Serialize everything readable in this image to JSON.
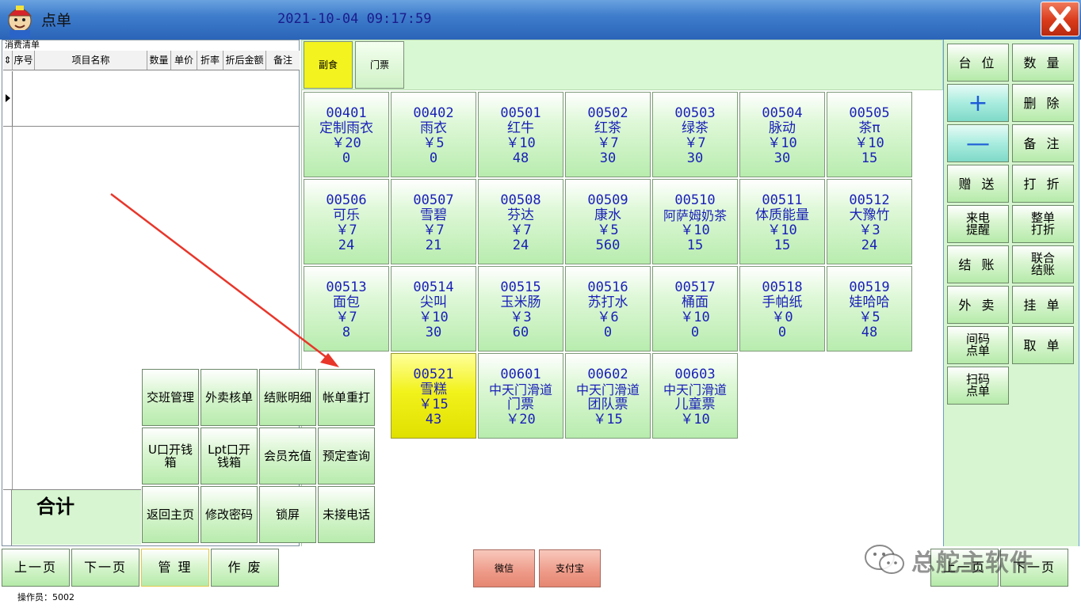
{
  "window": {
    "title": "点单",
    "datetime": "2021-10-04 09:17:59"
  },
  "order_list": {
    "caption": "消费清单",
    "columns": [
      "序号",
      "项目名称",
      "数量",
      "单价",
      "折率",
      "折后金额",
      "备注"
    ],
    "total_label": "合计"
  },
  "categories": [
    {
      "label": "副食",
      "active": true
    },
    {
      "label": "门票",
      "active": false
    }
  ],
  "products": [
    {
      "code": "00401",
      "name": "定制雨衣",
      "price": "￥20",
      "stock": "0"
    },
    {
      "code": "00402",
      "name": "雨衣",
      "price": "￥5",
      "stock": "0"
    },
    {
      "code": "00501",
      "name": "红牛",
      "price": "￥10",
      "stock": "48"
    },
    {
      "code": "00502",
      "name": "红茶",
      "price": "￥7",
      "stock": "30"
    },
    {
      "code": "00503",
      "name": "绿茶",
      "price": "￥7",
      "stock": "30"
    },
    {
      "code": "00504",
      "name": "脉动",
      "price": "￥10",
      "stock": "30"
    },
    {
      "code": "00505",
      "name": "茶π",
      "price": "￥10",
      "stock": "15"
    },
    {
      "code": "00506",
      "name": "可乐",
      "price": "￥7",
      "stock": "24"
    },
    {
      "code": "00507",
      "name": "雪碧",
      "price": "￥7",
      "stock": "21"
    },
    {
      "code": "00508",
      "name": "芬达",
      "price": "￥7",
      "stock": "24"
    },
    {
      "code": "00509",
      "name": "康水",
      "price": "￥5",
      "stock": "560"
    },
    {
      "code": "00510",
      "name": "阿萨姆奶茶",
      "price": "￥10",
      "stock": "15"
    },
    {
      "code": "00511",
      "name": "体质能量",
      "price": "￥10",
      "stock": "15"
    },
    {
      "code": "00512",
      "name": "大豫竹",
      "price": "￥3",
      "stock": "24"
    },
    {
      "code": "00513",
      "name": "面包",
      "price": "￥7",
      "stock": "8"
    },
    {
      "code": "00514",
      "name": "尖叫",
      "price": "￥10",
      "stock": "30"
    },
    {
      "code": "00515",
      "name": "玉米肠",
      "price": "￥3",
      "stock": "60"
    },
    {
      "code": "00516",
      "name": "苏打水",
      "price": "￥6",
      "stock": "0"
    },
    {
      "code": "00517",
      "name": "桶面",
      "price": "￥10",
      "stock": "0"
    },
    {
      "code": "00518",
      "name": "手帕纸",
      "price": "￥0",
      "stock": "0"
    },
    {
      "code": "00519",
      "name": "娃哈哈",
      "price": "￥5",
      "stock": "48"
    },
    {
      "code": "00521",
      "name": "雪糕",
      "price": "￥15",
      "stock": "43",
      "selected": true
    },
    {
      "code": "00601",
      "name": "中天门滑道",
      "name2": "门票",
      "price": "￥20"
    },
    {
      "code": "00602",
      "name": "中天门滑道",
      "name2": "团队票",
      "price": "￥15"
    },
    {
      "code": "00603",
      "name": "中天门滑道",
      "name2": "儿童票",
      "price": "￥10"
    }
  ],
  "management_menu": [
    {
      "line1": "交班管理"
    },
    {
      "line1": "外卖核单"
    },
    {
      "line1": "结账明细"
    },
    {
      "line1": "帐单重打"
    },
    {
      "line1": "U口开钱",
      "line2": "箱"
    },
    {
      "line1": "Lpt口开",
      "line2": "钱箱"
    },
    {
      "line1": "会员充值"
    },
    {
      "line1": "预定查询"
    },
    {
      "line1": "返回主页"
    },
    {
      "line1": "修改密码"
    },
    {
      "line1": "锁屏"
    },
    {
      "line1": "未接电话"
    }
  ],
  "functions": [
    {
      "line1": "台 位"
    },
    {
      "line1": "数 量"
    },
    {
      "line1": "+",
      "symbol": true
    },
    {
      "line1": "删 除"
    },
    {
      "line1": "—",
      "symbol": true
    },
    {
      "line1": "备 注"
    },
    {
      "line1": "赠 送"
    },
    {
      "line1": "打 折"
    },
    {
      "line1": "来电",
      "line2": "提醒"
    },
    {
      "line1": "整单",
      "line2": "打折"
    },
    {
      "line1": "结 账"
    },
    {
      "line1": "联合",
      "line2": "结账"
    },
    {
      "line1": "外 卖"
    },
    {
      "line1": "挂 单"
    },
    {
      "line1": "间码",
      "line2": "点单"
    },
    {
      "line1": "取 单"
    },
    {
      "line1": "扫码",
      "line2": "点单"
    }
  ],
  "bottom": {
    "prev_page": "上一页",
    "next_page": "下一页",
    "manage": "管 理",
    "void": "作 废",
    "wechat": "微信",
    "alipay": "支付宝",
    "right_prev": "上一页",
    "right_next": "下一页",
    "operator": "操作员：5002"
  },
  "watermark": "总舵主软件",
  "colors": {
    "title_bar": "#3f7dcc",
    "panel_green": "#d6f5d0",
    "product_text": "#1a20b8",
    "selected_yellow": "#f2f21c",
    "close_red": "#d83a1a",
    "pay_button": "#ee9a88",
    "annotation_arrow": "#e8362a"
  }
}
